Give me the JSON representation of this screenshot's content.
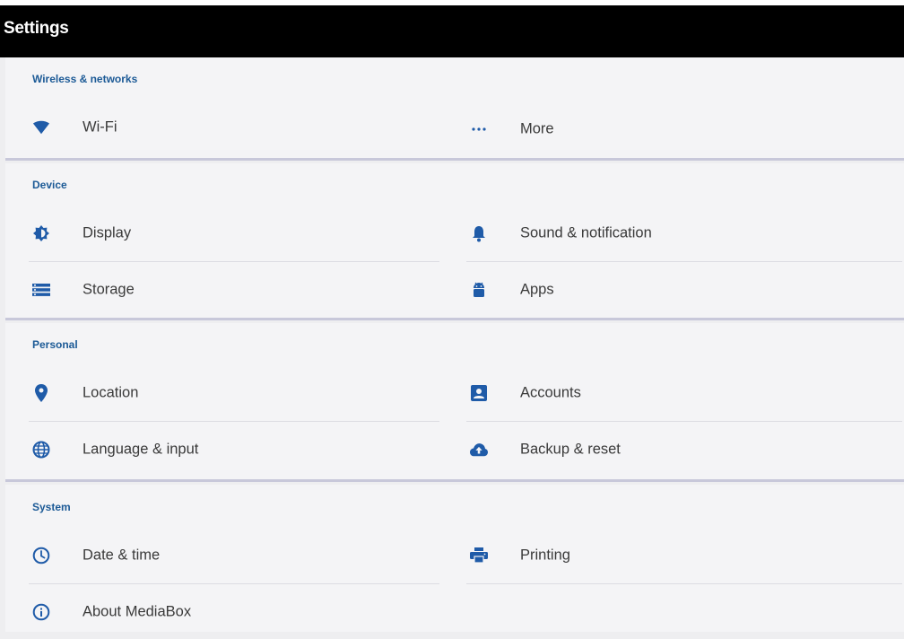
{
  "app": {
    "title": "Settings"
  },
  "sections": [
    {
      "header": "Wireless & networks",
      "left": [
        {
          "label": "Wi-Fi",
          "icon": "wifi-icon"
        }
      ],
      "right": [
        {
          "label": "More",
          "icon": "more-dots-icon"
        }
      ]
    },
    {
      "header": "Device",
      "left": [
        {
          "label": "Display",
          "icon": "brightness-icon"
        },
        {
          "label": "Storage",
          "icon": "storage-icon"
        }
      ],
      "right": [
        {
          "label": "Sound & notification",
          "icon": "bell-icon"
        },
        {
          "label": "Apps",
          "icon": "android-icon"
        }
      ]
    },
    {
      "header": "Personal",
      "left": [
        {
          "label": "Location",
          "icon": "location-pin-icon"
        },
        {
          "label": "Language & input",
          "icon": "globe-icon"
        }
      ],
      "right": [
        {
          "label": "Accounts",
          "icon": "account-box-icon"
        },
        {
          "label": "Backup & reset",
          "icon": "cloud-upload-icon"
        }
      ]
    },
    {
      "header": "System",
      "left": [
        {
          "label": "Date & time",
          "icon": "clock-icon"
        },
        {
          "label": "About MediaBox",
          "icon": "info-icon"
        }
      ],
      "right": [
        {
          "label": "Printing",
          "icon": "printer-icon"
        }
      ]
    }
  ],
  "colors": {
    "accent": "#1c5a96",
    "icon": "#1f5ba8",
    "app_bar": "#000000",
    "card_bg": "#f4f4f6",
    "page_bg": "#eeeef0"
  }
}
